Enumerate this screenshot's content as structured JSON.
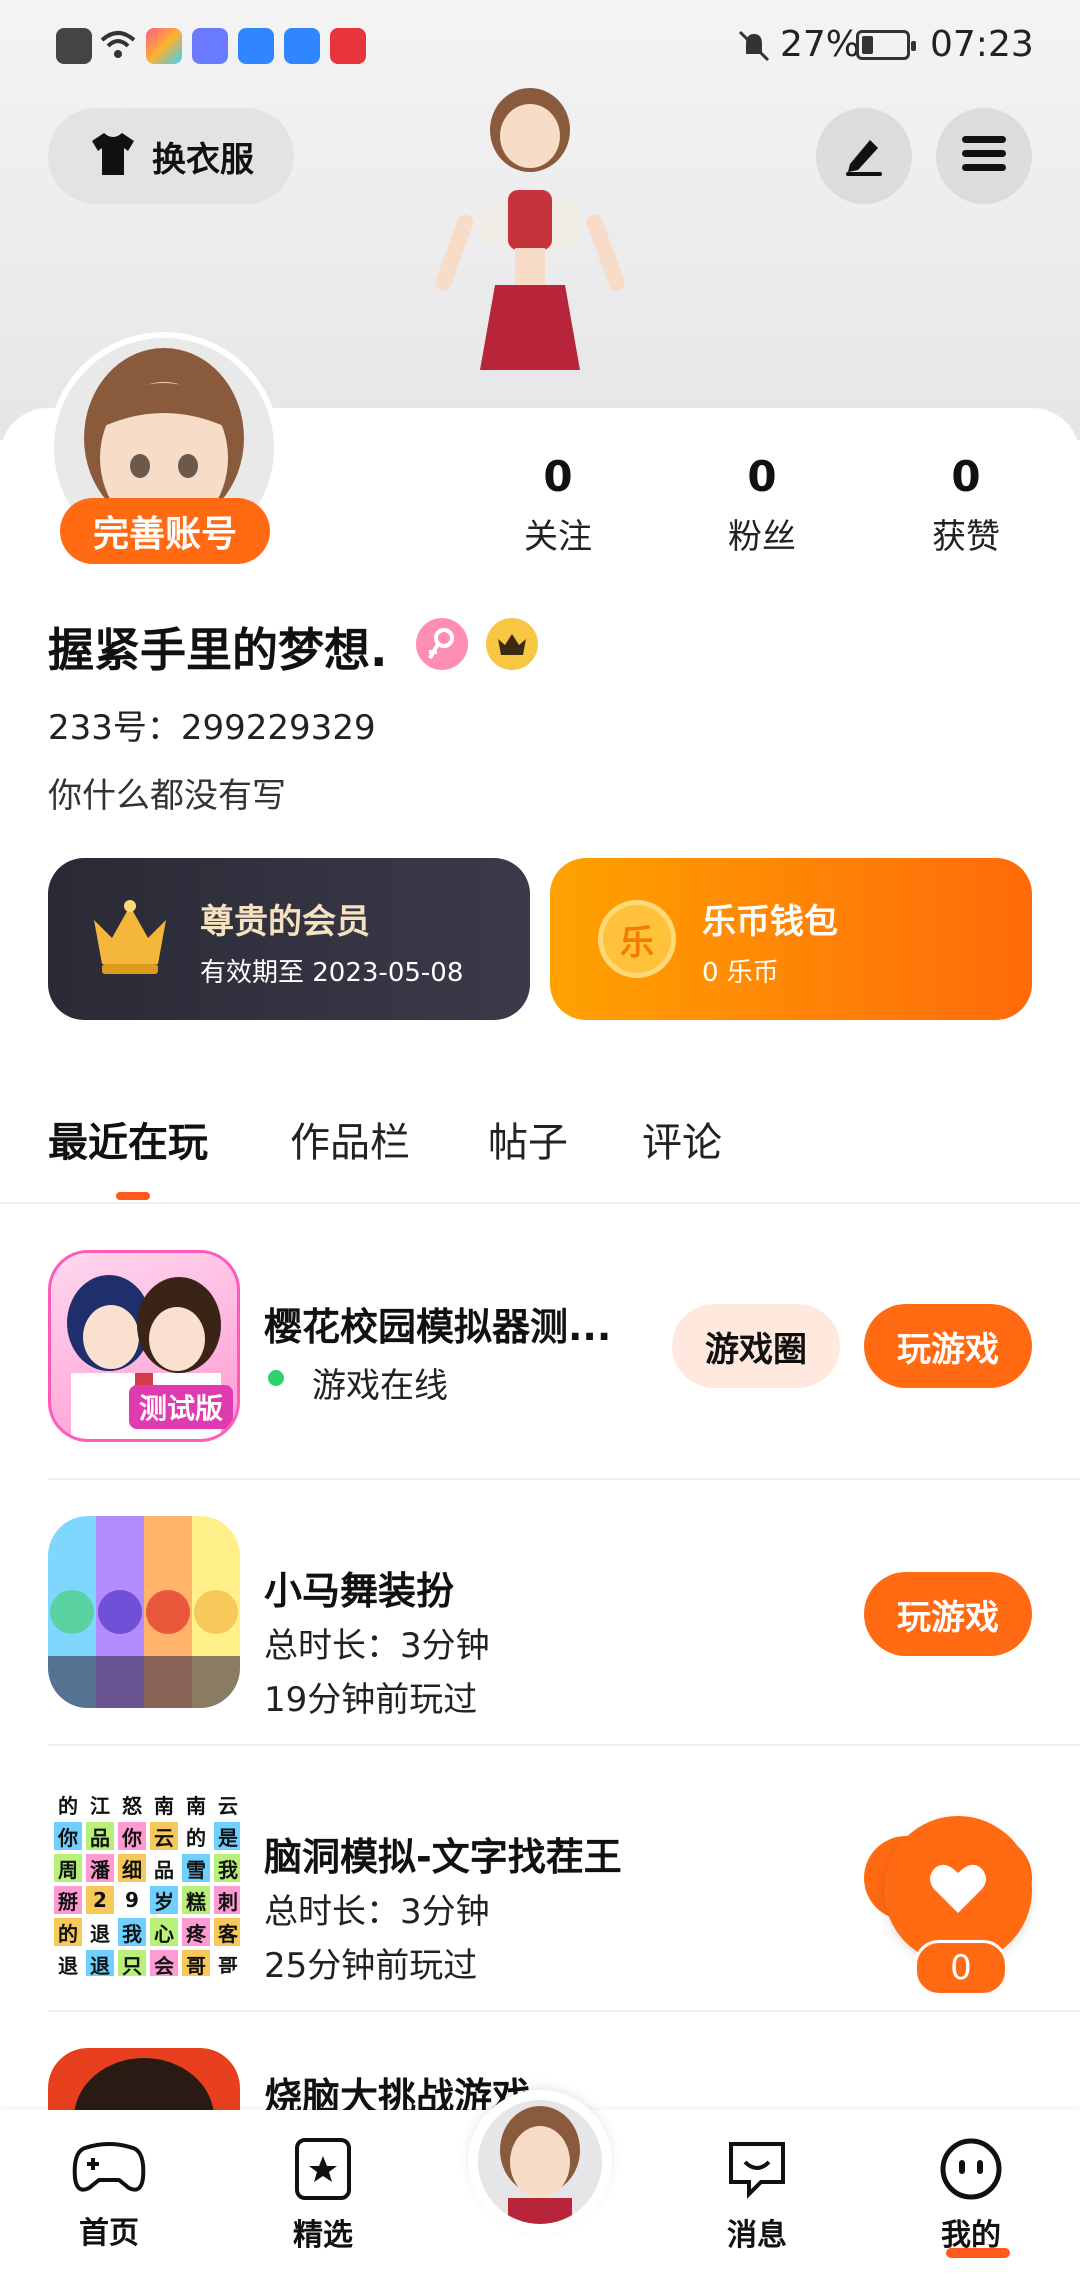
{
  "status_bar": {
    "battery": "27%",
    "time": "07:23",
    "battery_level": 0.27
  },
  "header": {
    "dress_up_label": "换衣服"
  },
  "profile": {
    "complete_account_label": "完善账号",
    "stats": [
      {
        "value": "0",
        "label": "关注"
      },
      {
        "value": "0",
        "label": "粉丝"
      },
      {
        "value": "0",
        "label": "获赞"
      }
    ],
    "username": "握紧手里的梦想.",
    "uid": "233号：299229329",
    "bio": "你什么都没有写"
  },
  "cards": {
    "member": {
      "title": "尊贵的会员",
      "subtitle": "有效期至 2023-05-08"
    },
    "wallet": {
      "title": "乐币钱包",
      "subtitle": "0 乐币",
      "coin_glyph": "乐"
    }
  },
  "tabs": [
    {
      "label": "最近在玩",
      "active": true
    },
    {
      "label": "作品栏",
      "active": false
    },
    {
      "label": "帖子",
      "active": false
    },
    {
      "label": "评论",
      "active": false
    }
  ],
  "games": [
    {
      "name": "樱花校园模拟器测...",
      "status": "游戏在线",
      "circle_label": "游戏圈",
      "play_label": "玩游戏",
      "icon_badge": "测试版"
    },
    {
      "name": "小马舞装扮",
      "duration": "总时长：3分钟",
      "last_played": "19分钟前玩过",
      "play_label": "玩游戏"
    },
    {
      "name": "脑洞模拟-文字找茬王",
      "duration": "总时长：3分钟",
      "last_played": "25分钟前玩过",
      "play_label": "玩游戏",
      "icon_grid": [
        "的",
        "江",
        "怒",
        "南",
        "南",
        "云",
        "你",
        "品",
        "你",
        "云",
        "的",
        "是",
        "周",
        "潘",
        "细",
        "品",
        "雪",
        "我",
        "掰",
        "2",
        "9",
        "岁",
        "糕",
        "刺",
        "的",
        "退",
        "我",
        "心",
        "疼",
        "客",
        "退",
        "退",
        "只",
        "会",
        "哥",
        "哥"
      ]
    },
    {
      "name": "烧脑大挑战游戏"
    }
  ],
  "fab": {
    "like_count": "0"
  },
  "bottom_nav": [
    {
      "label": "首页",
      "icon": "gamepad-icon"
    },
    {
      "label": "精选",
      "icon": "star-bookmark-icon"
    },
    {
      "label": "消息",
      "icon": "chat-bubble-icon"
    },
    {
      "label": "我的",
      "icon": "smiley-face-icon",
      "active": true
    }
  ],
  "colors": {
    "accent": "#ff6a12",
    "member_card": "#2a2a36",
    "online": "#2fd36e"
  }
}
